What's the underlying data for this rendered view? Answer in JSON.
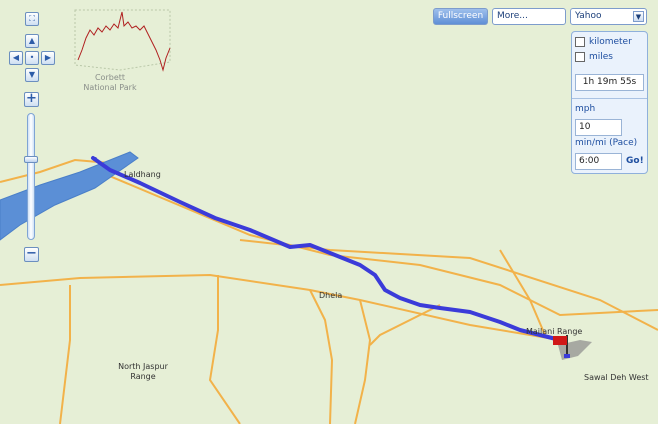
{
  "map": {
    "places": {
      "corbett": "Corbett\nNational Park",
      "corbett_line1": "Corbett",
      "corbett_line2": "National Park",
      "laldhang": "Laldhang",
      "dhela": "Dhela",
      "mailani": "Mailani Range",
      "north_jaspur_1": "North Jaspur",
      "north_jaspur_2": "Range",
      "sawal": "Sawal Deh West"
    },
    "colors": {
      "route": "#3b3bd9",
      "road": "#f2b24a",
      "water": "#5b8fd6",
      "land": "#e6efd6"
    }
  },
  "controls": {
    "zoom_in_label": "+",
    "zoom_out_label": "−",
    "pan_up": "▲",
    "pan_down": "▼",
    "pan_left": "◀",
    "pan_right": "▶",
    "pan_center": "•",
    "zoom_level_fraction": 0.36
  },
  "toolbar": {
    "fullscreen_label": "Fullscreen",
    "more_label": "More...",
    "provider_selected": "Yahoo"
  },
  "panel": {
    "unit_kilometer": "kilometer",
    "unit_miles": "miles",
    "duration": "1h 19m 55s",
    "speed_label": "mph",
    "speed_value": "10",
    "pace_label": "min/mi (Pace)",
    "pace_value": "6:00",
    "go_label": "Go!"
  }
}
